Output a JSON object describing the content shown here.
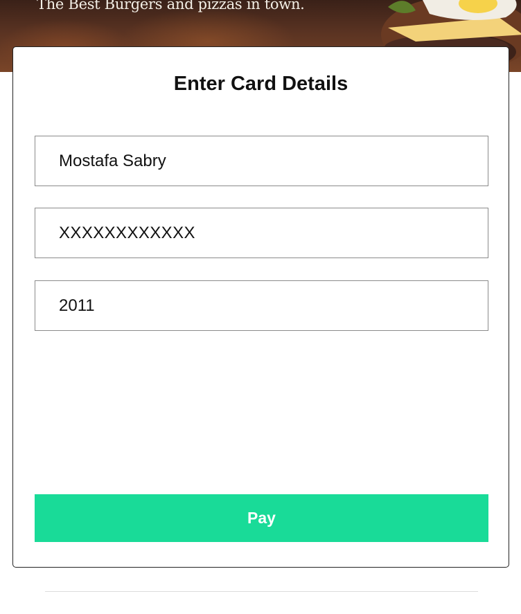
{
  "hero": {
    "tagline": "The Best Burgers and pizzas in town."
  },
  "payment_form": {
    "title": "Enter Card Details",
    "cardholder_name": "Mostafa Sabry",
    "card_number": "XXXXXXXXXXXX",
    "expiry": "2011",
    "pay_label": "Pay"
  },
  "colors": {
    "pay_button": "#19db98",
    "hero_background": "#5a3322"
  }
}
